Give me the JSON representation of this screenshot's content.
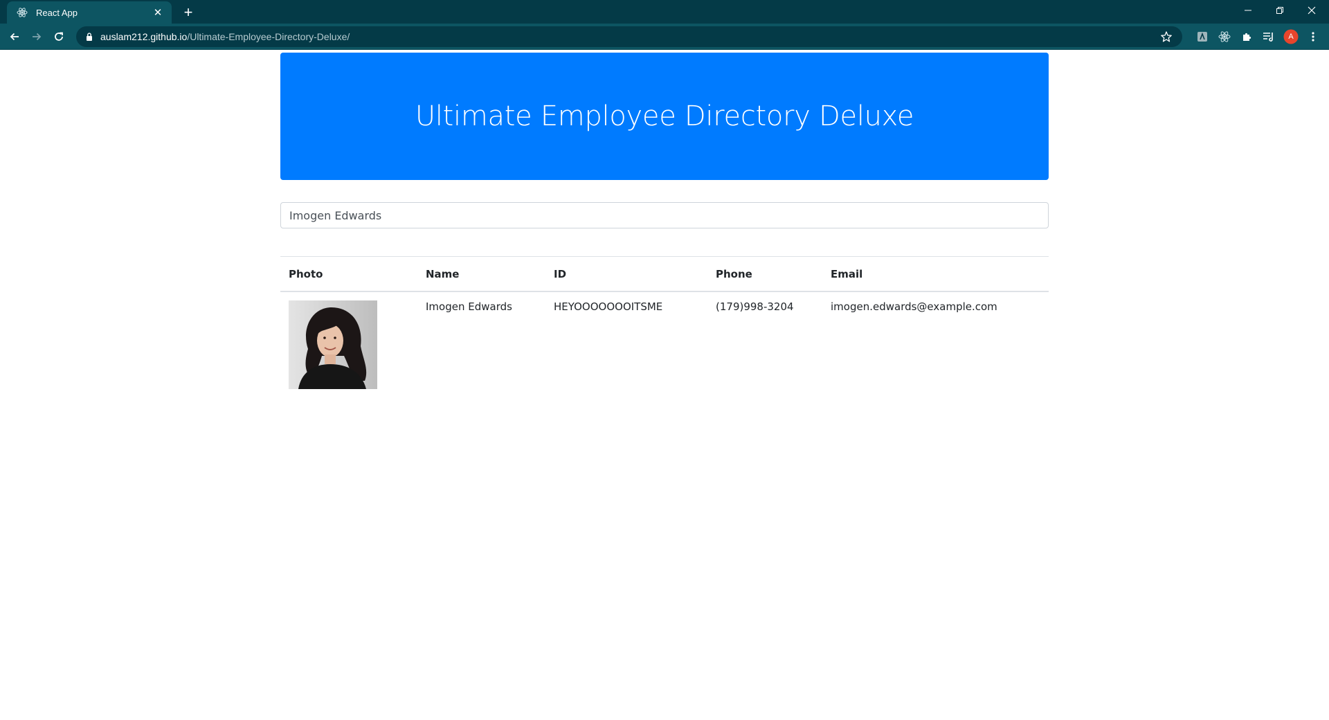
{
  "browser": {
    "tab_title": "React App",
    "tab_close": "✕",
    "new_tab": "+",
    "url_host": "auslam212.github.io",
    "url_path": "/Ultimate-Employee-Directory-Deluxe/",
    "profile_initial": "A",
    "colors": {
      "frame": "#043a47",
      "toolbar": "#0d5562",
      "profile": "#e8452c"
    }
  },
  "header": {
    "title": "Ultimate Employee Directory Deluxe",
    "color": "#007bff"
  },
  "search": {
    "value": "Imogen Edwards"
  },
  "table": {
    "columns": [
      "Photo",
      "Name",
      "ID",
      "Phone",
      "Email"
    ],
    "rows": [
      {
        "photo": "employee-portrait",
        "name": "Imogen Edwards",
        "id": "HEYOOOOOOOITSME",
        "phone": "(179)998-3204",
        "email": "imogen.edwards@example.com"
      }
    ]
  }
}
